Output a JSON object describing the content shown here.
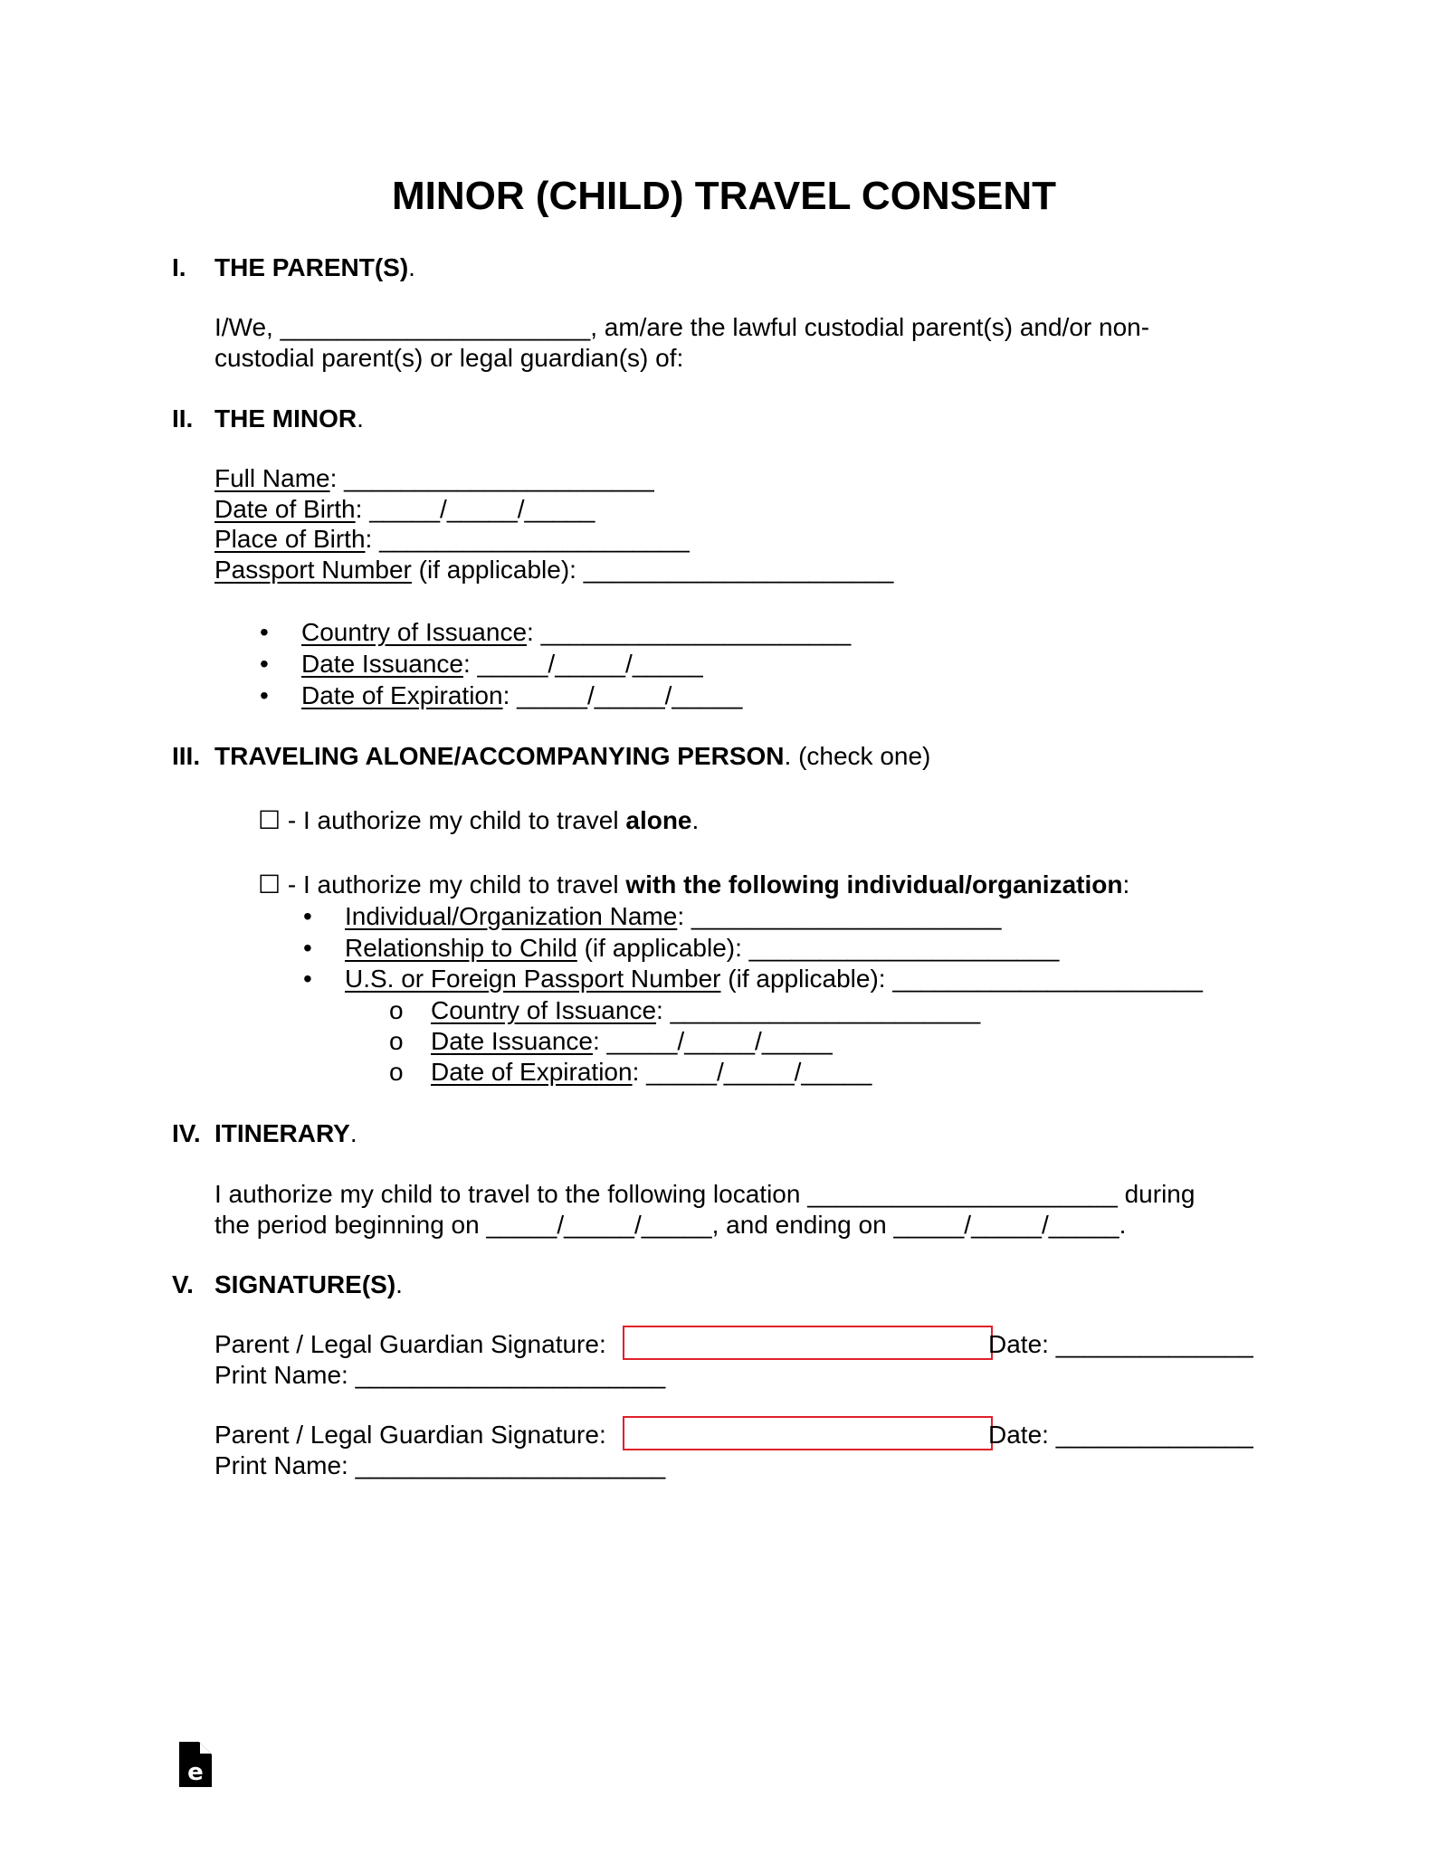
{
  "title": "MINOR (CHILD) TRAVEL CONSENT",
  "sections": {
    "parents": {
      "num": "I.",
      "heading": "THE PARENT(S)",
      "line1": "I/We, ______________________, am/are the lawful custodial parent(s) and/or non-",
      "line2": "custodial parent(s) or legal guardian(s) of:"
    },
    "minor": {
      "num": "II.",
      "heading": "THE MINOR",
      "fields": [
        {
          "label": "Full Name",
          "rest": ": ______________________"
        },
        {
          "label": "Date of Birth",
          "rest": ": _____/_____/_____"
        },
        {
          "label": "Place of Birth",
          "rest": ": ______________________"
        },
        {
          "label": "Passport Number",
          "rest": " (if applicable): ______________________"
        }
      ],
      "passport_fields": [
        {
          "label": "Country of Issuance",
          "rest": ": ______________________"
        },
        {
          "label": "Date Issuance",
          "rest": ": _____/_____/_____"
        },
        {
          "label": "Date of Expiration",
          "rest": ": _____/_____/_____"
        }
      ]
    },
    "travel": {
      "num": "III.",
      "heading": "TRAVELING ALONE/ACCOMPANYING PERSON",
      "note": ". (check one)",
      "option_alone_pre": "- I authorize my child to travel ",
      "option_alone_bold": "alone",
      "option_with_pre": "- I authorize my child to travel ",
      "option_with_bold": "with the following individual/organization",
      "companion_fields": [
        {
          "label": "Individual/Organization Name",
          "rest": ": ______________________"
        },
        {
          "label": "Relationship to Child",
          "rest": " (if applicable): ______________________"
        },
        {
          "label": "U.S. or Foreign Passport Number",
          "rest": " (if applicable): ______________________"
        }
      ],
      "companion_passport_fields": [
        {
          "label": "Country of Issuance",
          "rest": ": ______________________"
        },
        {
          "label": "Date Issuance",
          "rest": ": _____/_____/_____"
        },
        {
          "label": "Date of Expiration",
          "rest": ": _____/_____/_____"
        }
      ]
    },
    "itinerary": {
      "num": "IV.",
      "heading": "ITINERARY",
      "line1": "I authorize my child to travel to the following location ______________________ during",
      "line2": "the period beginning on _____/_____/_____, and ending on _____/_____/_____."
    },
    "signatures": {
      "num": "V.",
      "heading": "SIGNATURE(S)",
      "blocks": [
        {
          "sig_label": "Parent / Legal Guardian Signature:",
          "date_label": "Date: ______________",
          "print_label": "Print Name: ______________________"
        },
        {
          "sig_label": "Parent / Legal Guardian Signature:",
          "date_label": "Date: ______________",
          "print_label": "Print Name: ______________________"
        }
      ]
    }
  },
  "checkbox_glyph": "☐",
  "bullet_glyph": "•",
  "sub_bullet_glyph": "o",
  "period": ".",
  "colon": ":",
  "signature_box_color": "#e0202a"
}
